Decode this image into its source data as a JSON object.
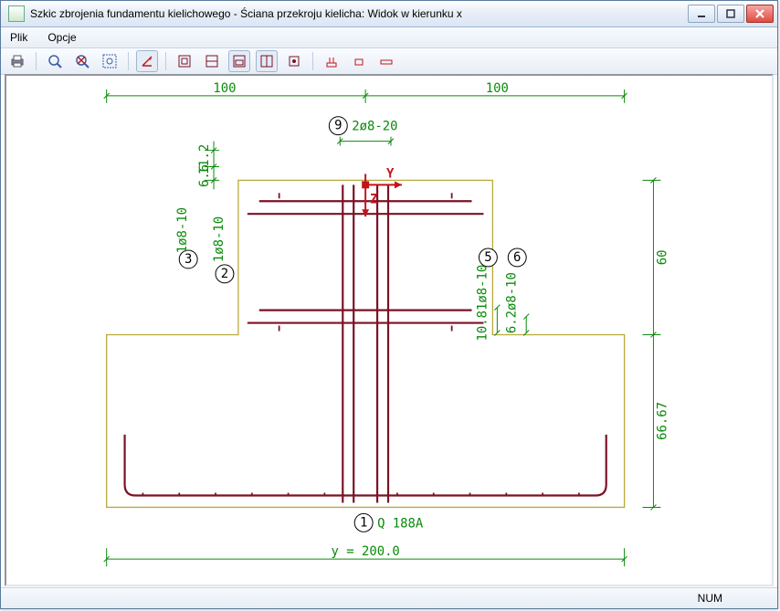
{
  "window": {
    "title": "Szkic zbrojenia fundamentu kielichowego - Ściana przekroju kielicha: Widok w kierunku x"
  },
  "menu": {
    "file": "Plik",
    "options": "Opcje"
  },
  "status": {
    "num": "NUM"
  },
  "dims": {
    "top_left": "100",
    "top_right": "100",
    "right_upper": "60",
    "right_lower": "66.67",
    "bottom": "y = 200.0",
    "notch_top": "11.2",
    "notch_bot": "6.6"
  },
  "labels": {
    "n1": "1",
    "n1_txt": "Q 188A",
    "n2": "2",
    "n2_txt": "1ø8-10",
    "n3": "3",
    "n3_txt": "1ø8-10",
    "n5": "5",
    "n5_txt": "10.81ø8-10",
    "n6": "6",
    "n6_txt": "6.2ø8-10",
    "n9": "9",
    "n9_txt": "2ø8-20"
  },
  "axis": {
    "y": "Y",
    "z": "Z"
  }
}
